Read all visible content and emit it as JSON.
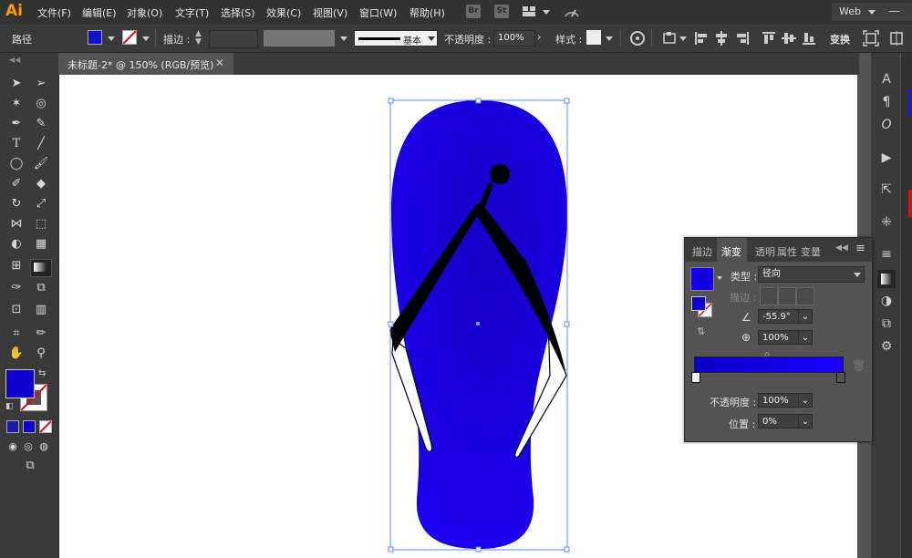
{
  "app": {
    "logo": "Ai",
    "workspace": "Web"
  },
  "menu": [
    "文件(F)",
    "编辑(E)",
    "对象(O)",
    "文字(T)",
    "选择(S)",
    "效果(C)",
    "视图(V)",
    "窗口(W)",
    "帮助(H)"
  ],
  "bridge": {
    "br": "Br",
    "st": "St"
  },
  "control": {
    "path_label": "路径",
    "fill_color": "#1111cc",
    "stroke_label": "描边 :",
    "stroke_profile": "基本",
    "opacity_label": "不透明度 :",
    "opacity_value": "100%",
    "style_label": "样式 :",
    "transform_label": "变换"
  },
  "document_tab": "未标题-2* @ 150% (RGB/预览)",
  "tools": {
    "fill_color": "#1000cc",
    "swatch_colors": [
      "#1a1aa8",
      "#1000cc"
    ]
  },
  "panel": {
    "tabs": [
      "描边",
      "渐变",
      "透明",
      "属性",
      "变量"
    ],
    "active_tab": "渐变",
    "type_label": "类型 :",
    "type_value": "径向",
    "stroke_label": "描边 :",
    "angle_value": "-55.9°",
    "aspect_value": "100%",
    "opacity_label": "不透明度 :",
    "opacity_value": "100%",
    "location_label": "位置 :",
    "location_value": "0%",
    "gradient": {
      "start": "#0a00c8",
      "end": "#1a00ff"
    }
  },
  "artwork": {
    "sole_color_center": "#1400c4",
    "sole_color_edge": "#1c00f5",
    "strap_color": "#000000"
  }
}
